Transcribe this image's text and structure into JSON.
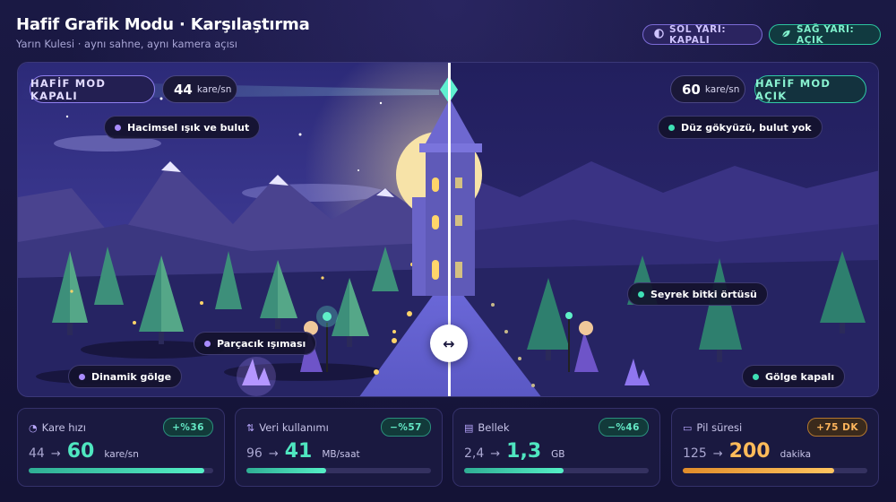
{
  "header": {
    "title": "Hafif Grafik Modu · Karşılaştırma",
    "subtitle": "Yarın Kulesi · aynı sahne, aynı kamera açısı",
    "left_pill": "SOL YARI: KAPALI",
    "right_pill": "SAĞ YARI: AÇIK"
  },
  "scene": {
    "left": {
      "mode_label": "HAFİF MOD KAPALI",
      "fps_value": "44",
      "fps_unit": "kare/sn",
      "tags": [
        "Hacimsel ışık ve bulut",
        "Parçacık ışıması",
        "Dinamik gölge"
      ]
    },
    "right": {
      "mode_label": "HAFİF MOD AÇIK",
      "fps_value": "60",
      "fps_unit": "kare/sn",
      "tags": [
        "Düz gökyüzü, bulut yok",
        "Seyrek bitki örtüsü",
        "Gölge kapalı"
      ]
    },
    "split_handle_label": "↔"
  },
  "stats": [
    {
      "label": "Kare hızı",
      "icon": "gauge-icon",
      "from": "44",
      "to": "60",
      "unit": "kare/sn",
      "delta": "+%36",
      "progress": 0.95,
      "accent": "teal"
    },
    {
      "label": "Veri kullanımı",
      "icon": "transfer-icon",
      "from": "96",
      "to": "41",
      "unit": "MB/saat",
      "delta": "−%57",
      "progress": 0.43,
      "accent": "teal"
    },
    {
      "label": "Bellek",
      "icon": "memory-icon",
      "from": "2,4",
      "to": "1,3",
      "unit": "GB",
      "delta": "−%46",
      "progress": 0.54,
      "accent": "teal"
    },
    {
      "label": "Pil süresi",
      "icon": "battery-icon",
      "from": "125",
      "to": "200",
      "unit": "dakika",
      "delta": "+75 DK",
      "progress": 0.82,
      "accent": "amber"
    }
  ],
  "colors": {
    "accent_teal": "#4fe6c0",
    "accent_amber": "#ffbb5a",
    "accent_purple": "#a98cff",
    "background": "#15143a"
  }
}
